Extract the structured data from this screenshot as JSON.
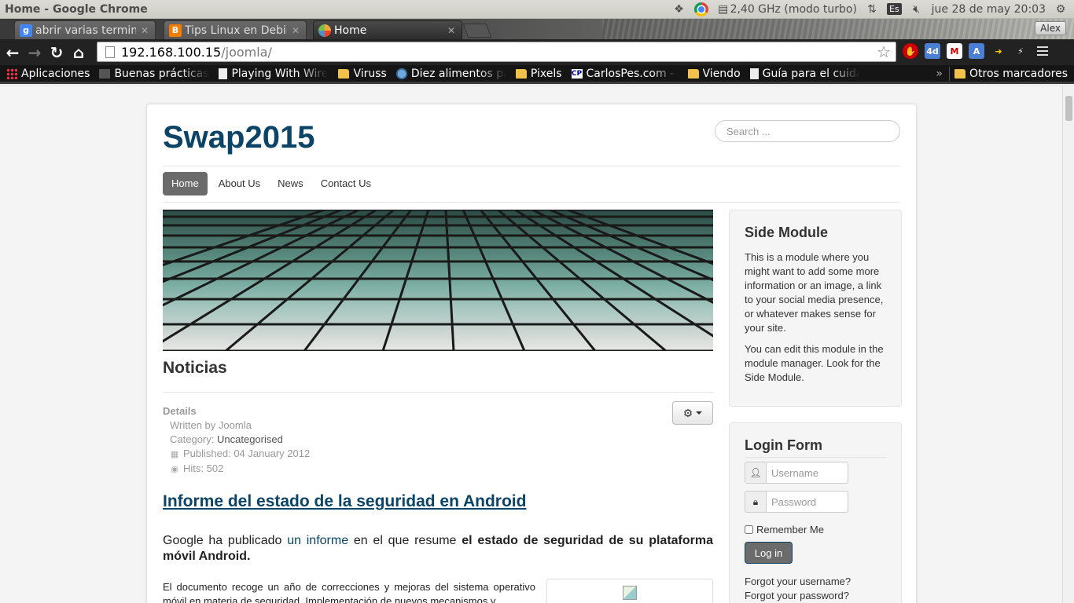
{
  "window": {
    "title": "Home - Google Chrome",
    "tray": {
      "cpu": "2,40 GHz (modo turbo)",
      "keyboard": "Es",
      "datetime": "jue 28 de may 20:03"
    }
  },
  "tabs": [
    {
      "label": "abrir varias terminal",
      "icon": "google-favicon"
    },
    {
      "label": "Tips Linux en Debian",
      "icon": "blogger-favicon"
    },
    {
      "label": "Home",
      "icon": "joomla-favicon",
      "active": true
    }
  ],
  "profile": {
    "name": "Alex"
  },
  "omnibox": {
    "host": "192.168.100.15",
    "path": "/joomla/"
  },
  "bookmarks": [
    {
      "label": "Aplicaciones",
      "type": "apps"
    },
    {
      "label": "Buenas prácticas",
      "type": "sbd"
    },
    {
      "label": "Playing With Wire",
      "type": "page"
    },
    {
      "label": "Viruss",
      "type": "folder"
    },
    {
      "label": "Diez alimentos pa",
      "type": "globe"
    },
    {
      "label": "Pixels",
      "type": "folder"
    },
    {
      "label": "CarlosPes.com - C",
      "type": "cp"
    },
    {
      "label": "Viendo",
      "type": "folder"
    },
    {
      "label": "Guía para el cuida",
      "type": "page"
    },
    {
      "label": "Otros marcadores",
      "type": "folder"
    }
  ],
  "bookmarks_chevron": "»",
  "site": {
    "title": "Swap2015",
    "search_placeholder": "Search ...",
    "nav": [
      {
        "label": "Home",
        "active": true
      },
      {
        "label": "About Us"
      },
      {
        "label": "News"
      },
      {
        "label": "Contact Us"
      }
    ]
  },
  "main": {
    "heading": "Noticias",
    "details": {
      "label": "Details",
      "written_by": "Written by Joomla",
      "category_label": "Category:",
      "category": "Uncategorised",
      "published": "Published: 04 January 2012",
      "hits": "Hits: 502"
    },
    "article_title": "Informe del estado de la seguridad en Android",
    "lead": {
      "part1": "Google ha publicado",
      "link": "un informe",
      "part2": "en el que resume",
      "bold": "el estado de seguridad de su plataforma móvil Android."
    },
    "body": "El documento recoge un año de correcciones y mejoras del sistema operativo móvil en materia de seguridad. Implementación de nuevos mecanismos y"
  },
  "sidebar": {
    "module_title": "Side Module",
    "module_p1": "This is a module where you might want to add some more information or an image, a link to your social media presence, or whatever makes sense for your site.",
    "module_p2": "You can edit this module in the module manager. Look for the Side Module.",
    "login_title": "Login Form",
    "username_placeholder": "Username",
    "password_placeholder": "Password",
    "remember_label": "Remember Me",
    "login_button": "Log in",
    "forgot_username": "Forgot your username?",
    "forgot_password": "Forgot your password?"
  }
}
